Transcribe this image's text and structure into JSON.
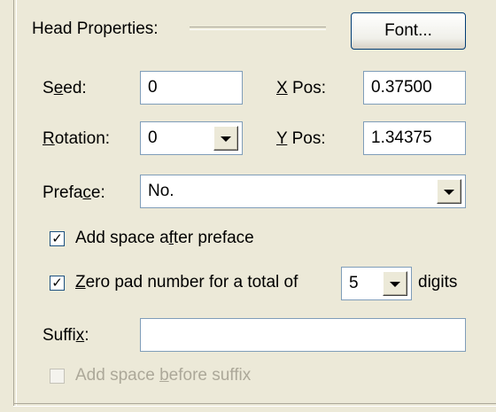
{
  "head_properties": {
    "title": "Head Properties:",
    "font_button": "Font..."
  },
  "seed": {
    "label_pre": "S",
    "label_ul": "e",
    "label_post": "ed:",
    "value": "0"
  },
  "x_pos": {
    "label_ul": "X",
    "label_post": " Pos:",
    "value": "0.37500"
  },
  "rotation": {
    "label_ul": "R",
    "label_post": "otation:",
    "value": "0"
  },
  "y_pos": {
    "label_ul": "Y",
    "label_post": " Pos:",
    "value": "1.34375"
  },
  "preface": {
    "label_pre": "Prefa",
    "label_ul": "c",
    "label_post": "e:",
    "value": "No."
  },
  "add_space_after": {
    "checked": true,
    "label_pre": "Add space a",
    "label_ul": "f",
    "label_post": "ter preface"
  },
  "zero_pad": {
    "checked": true,
    "label_ul": "Z",
    "label_post": "ero pad number for a total of",
    "digits_value": "5",
    "suffix_pre": "di",
    "suffix_ul": "g",
    "suffix_post": "its"
  },
  "suffix": {
    "label_pre": "Suffi",
    "label_ul": "x",
    "label_post": ":",
    "value": ""
  },
  "add_space_before": {
    "checked": false,
    "enabled": false,
    "label_pre": "Add space ",
    "label_ul": "b",
    "label_post": "efore suffix"
  },
  "colors": {
    "background": "#ece9d8",
    "field_border": "#7f9db9",
    "disabled_text": "#aca899"
  },
  "icons": {
    "dropdown": "chevron-down-icon",
    "check": "check-icon"
  }
}
